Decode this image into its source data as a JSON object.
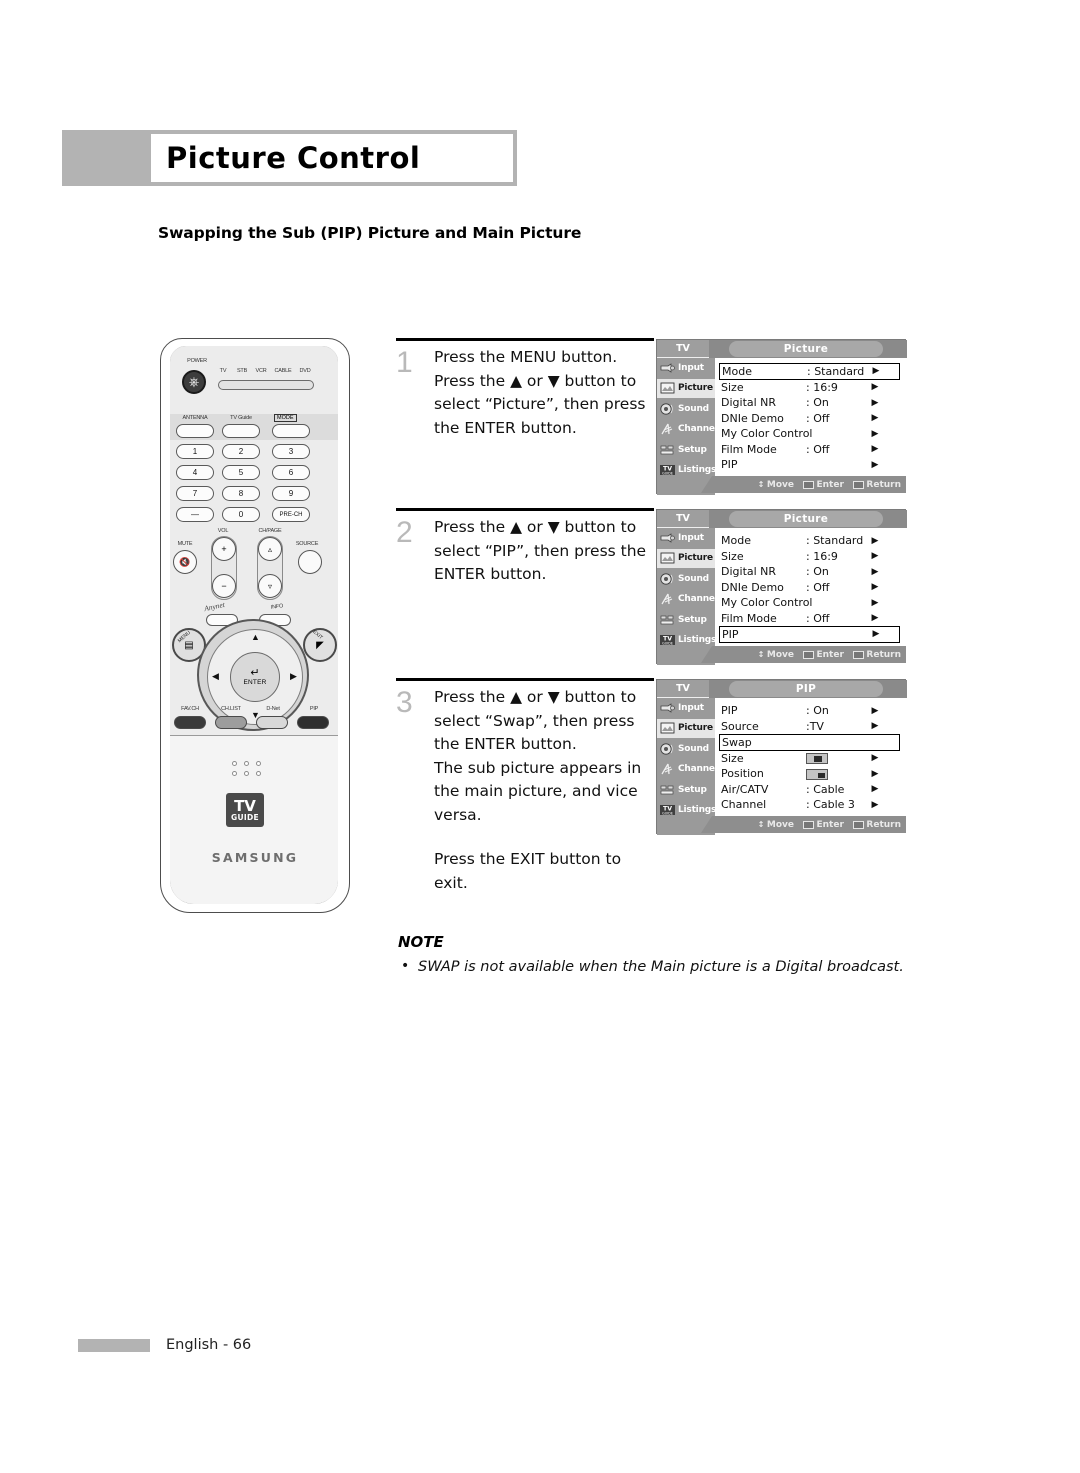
{
  "page": {
    "title": "Picture Control",
    "subtitle": "Swapping the Sub (PIP) Picture and Main Picture",
    "footer_text": "English - 66",
    "accent_gray": "#b3b3b3"
  },
  "remote": {
    "power_label": "POWER",
    "mode_labels": [
      "TV",
      "STB",
      "VCR",
      "CABLE",
      "DVD"
    ],
    "fn_buttons": [
      {
        "label": "ANTENNA"
      },
      {
        "label": "TV Guide"
      },
      {
        "label": "MODE"
      }
    ],
    "keypad": [
      "1",
      "2",
      "3",
      "4",
      "5",
      "6",
      "7",
      "8",
      "9",
      "—",
      "0",
      "PRE-CH"
    ],
    "vol_label": "VOL",
    "chpage_label": "CH/PAGE",
    "mute_label": "MUTE",
    "source_label": "SOURCE",
    "anynet_label": "Anynet",
    "info_label": "INFO",
    "menu_label": "MENU",
    "exit_label": "EXIT",
    "enter_label": "ENTER",
    "bottom_buttons": [
      "FAV.CH",
      "CH.LIST",
      "D-Net",
      "PIP"
    ],
    "logo_tv": "TV",
    "logo_guide": "GUIDE",
    "brand": "SAMSUNG"
  },
  "steps": [
    {
      "number": "1",
      "lines": [
        "Press the MENU button.",
        "Press the ▲ or ▼ button to select “Picture”, then press the ENTER button."
      ]
    },
    {
      "number": "2",
      "lines": [
        "Press the ▲ or ▼ button to select “PIP”, then press the ENTER button."
      ]
    },
    {
      "number": "3",
      "lines": [
        "Press the ▲ or ▼ button to select “Swap”, then press the ENTER button.",
        "The sub picture appears in the main picture, and vice versa."
      ],
      "extra_line": "Press the EXIT button to exit."
    }
  ],
  "osd_common": {
    "tv_label": "TV",
    "sidebar": [
      {
        "label": "Input",
        "icon": "camera-icon"
      },
      {
        "label": "Picture",
        "icon": "picture-icon"
      },
      {
        "label": "Sound",
        "icon": "speaker-icon"
      },
      {
        "label": "Channel",
        "icon": "antenna-icon"
      },
      {
        "label": "Setup",
        "icon": "setup-icon"
      },
      {
        "label": "Listings",
        "icon": "tvguide-icon"
      }
    ],
    "selected_sidebar": "Picture",
    "hints": [
      {
        "label": "Move",
        "icon": "updown-arrow-icon"
      },
      {
        "label": "Enter",
        "icon": "enter-key-icon"
      },
      {
        "label": "Return",
        "icon": "return-key-icon"
      }
    ]
  },
  "osd_panels": [
    {
      "id": "picture-menu-1",
      "title": "Picture",
      "rows": [
        {
          "label": "Mode",
          "value": ": Standard",
          "arrow": true,
          "highlight": true
        },
        {
          "label": "Size",
          "value": ": 16:9",
          "arrow": true
        },
        {
          "label": "Digital NR",
          "value": ": On",
          "arrow": true
        },
        {
          "label": "DNIe Demo",
          "value": ": Off",
          "arrow": true
        },
        {
          "label": "My Color Control",
          "value": "",
          "arrow": true
        },
        {
          "label": "Film Mode",
          "value": ": Off",
          "arrow": true
        },
        {
          "label": "PIP",
          "value": "",
          "arrow": true
        }
      ]
    },
    {
      "id": "picture-menu-2",
      "title": "Picture",
      "rows": [
        {
          "label": "Mode",
          "value": ": Standard",
          "arrow": true
        },
        {
          "label": "Size",
          "value": ": 16:9",
          "arrow": true
        },
        {
          "label": "Digital NR",
          "value": ": On",
          "arrow": true
        },
        {
          "label": "DNIe Demo",
          "value": ": Off",
          "arrow": true
        },
        {
          "label": "My Color Control",
          "value": "",
          "arrow": true
        },
        {
          "label": "Film Mode",
          "value": ": Off",
          "arrow": true
        },
        {
          "label": "PIP",
          "value": "",
          "arrow": true,
          "highlight": true
        }
      ]
    },
    {
      "id": "pip-menu",
      "title": "PIP",
      "rows": [
        {
          "label": "PIP",
          "value": ": On",
          "arrow": true
        },
        {
          "label": "Source",
          "value": ":TV",
          "arrow": true
        },
        {
          "label": "Swap",
          "value": "",
          "arrow": false,
          "highlight": true
        },
        {
          "label": "Size",
          "value": "",
          "arrow": true,
          "swatch": "size"
        },
        {
          "label": "Position",
          "value": "",
          "arrow": true,
          "swatch": "position"
        },
        {
          "label": "Air/CATV",
          "value": ": Cable",
          "arrow": true
        },
        {
          "label": "Channel",
          "value": ": Cable 3",
          "arrow": true
        }
      ]
    }
  ],
  "note": {
    "label": "NOTE",
    "items": [
      "SWAP is not available when the Main picture is a Digital broadcast."
    ]
  }
}
